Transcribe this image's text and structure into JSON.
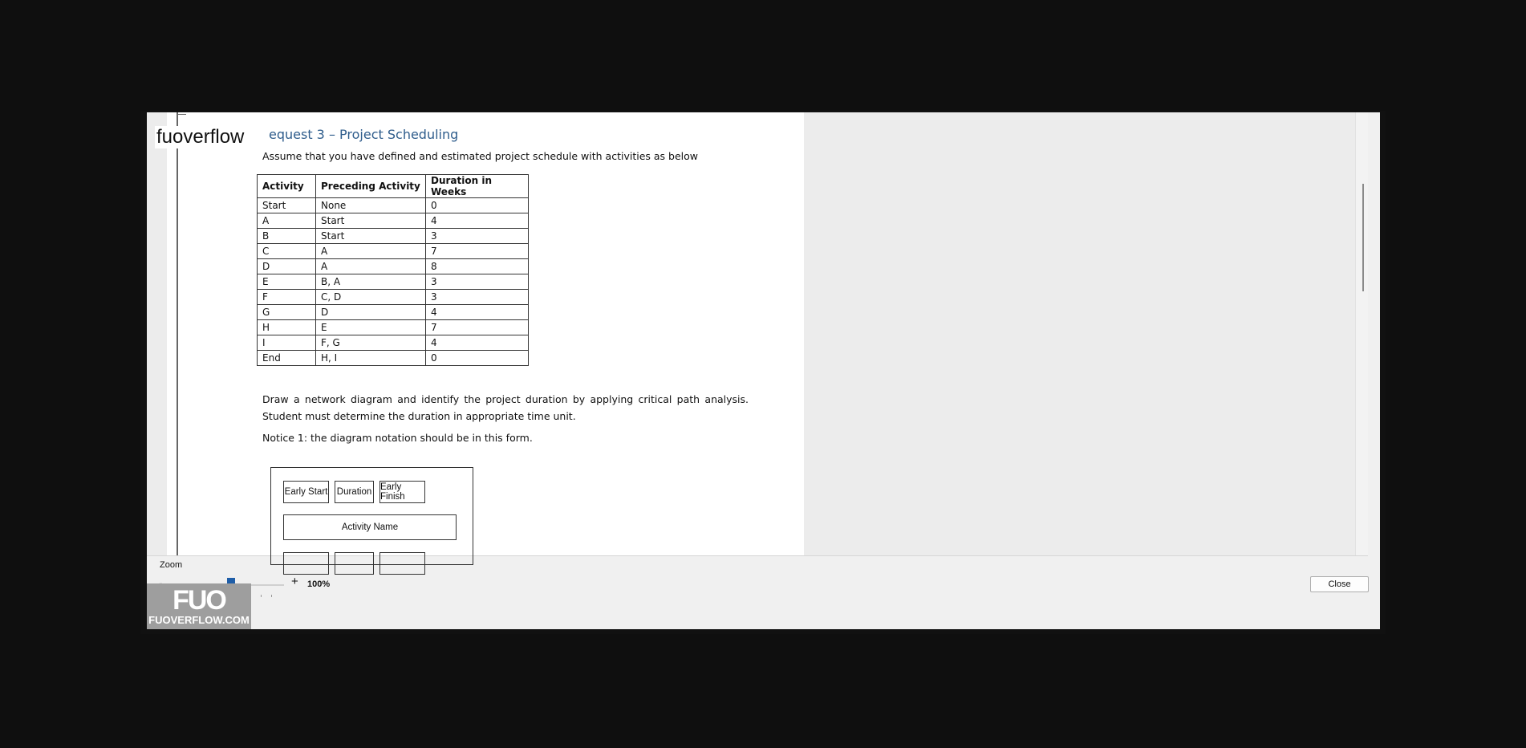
{
  "brand": "fuoverflow",
  "document": {
    "heading": "equest 3 – Project Scheduling",
    "intro": "Assume that you have defined and estimated project schedule with activities as below",
    "table": {
      "headers": [
        "Activity",
        "Preceding Activity",
        "Duration in Weeks"
      ],
      "rows": [
        [
          "Start",
          "None",
          "0"
        ],
        [
          "A",
          "Start",
          "4"
        ],
        [
          "B",
          "Start",
          "3"
        ],
        [
          "C",
          "A",
          "7"
        ],
        [
          "D",
          "A",
          "8"
        ],
        [
          "E",
          "B, A",
          "3"
        ],
        [
          "F",
          "C, D",
          "3"
        ],
        [
          "G",
          "D",
          "4"
        ],
        [
          "H",
          "E",
          "7"
        ],
        [
          "I",
          "F, G",
          "4"
        ],
        [
          "End",
          "H, I",
          "0"
        ]
      ]
    },
    "paragraph": "Draw a network diagram and identify the project duration by applying critical path analysis. Student must determine the duration in appropriate time unit.",
    "notice": "Notice 1: the diagram notation should be in this form.",
    "diagram": {
      "early_start": "Early Start",
      "duration": "Duration",
      "early_finish": "Early Finish",
      "activity_name": "Activity Name"
    }
  },
  "zoom": {
    "label": "Zoom",
    "minus": "-",
    "plus": "+",
    "value": "100%",
    "slider_fraction": 0.5
  },
  "close_label": "Close",
  "watermark": {
    "mark": "FUO",
    "text": "FUOVERFLOW.COM"
  },
  "colors": {
    "heading": "#2f5d8c",
    "slider_thumb": "#1f5ea8"
  }
}
